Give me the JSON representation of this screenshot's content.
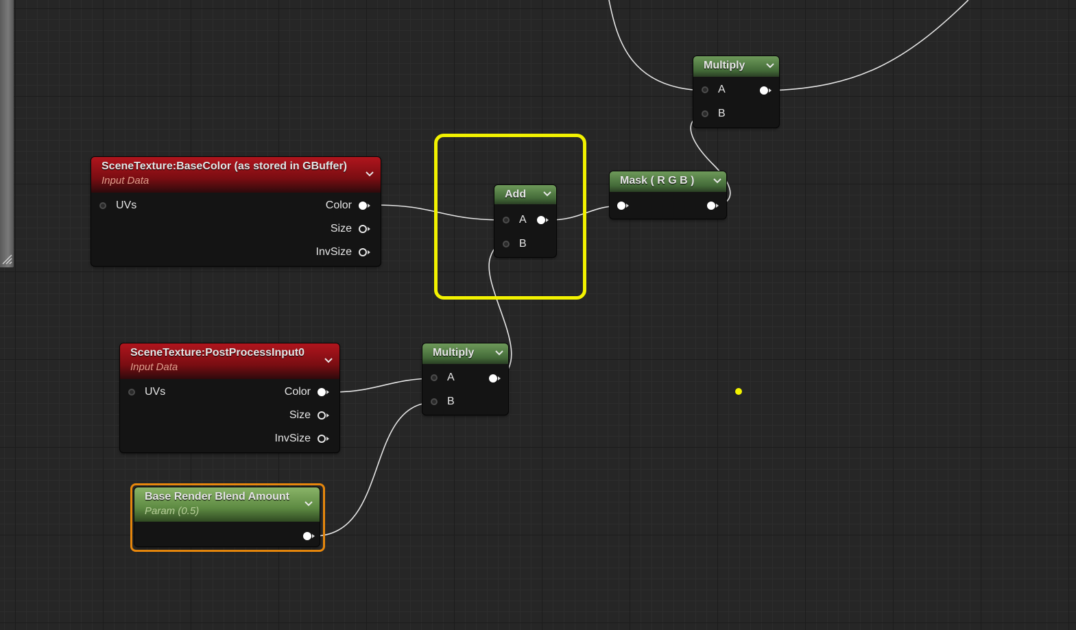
{
  "graph": {
    "nodes": {
      "basecolor": {
        "title": "SceneTexture:BaseColor (as stored in GBuffer)",
        "subtitle": "Input Data",
        "inputs": [
          "UVs"
        ],
        "outputs": [
          "Color",
          "Size",
          "InvSize"
        ]
      },
      "postprocess": {
        "title": "SceneTexture:PostProcessInput0",
        "subtitle": "Input Data",
        "inputs": [
          "UVs"
        ],
        "outputs": [
          "Color",
          "Size",
          "InvSize"
        ]
      },
      "blend_param": {
        "title": "Base Render Blend Amount",
        "subtitle": "Param (0.5)"
      },
      "add": {
        "title": "Add",
        "inputs": [
          "A",
          "B"
        ]
      },
      "multiply_bottom": {
        "title": "Multiply",
        "inputs": [
          "A",
          "B"
        ]
      },
      "mask": {
        "title": "Mask ( R G B )"
      },
      "multiply_top": {
        "title": "Multiply",
        "inputs": [
          "A",
          "B"
        ]
      }
    },
    "colors": {
      "canvas": "#262626",
      "input_header": "#9a1219",
      "math_header": "#4f7a40",
      "param_header": "#6a9a4a",
      "highlight": "#f2f200",
      "selection": "#e7870c",
      "wire": "#e6e6e6"
    },
    "icons": [
      "chevron-down-icon",
      "resize-grip-icon"
    ]
  }
}
